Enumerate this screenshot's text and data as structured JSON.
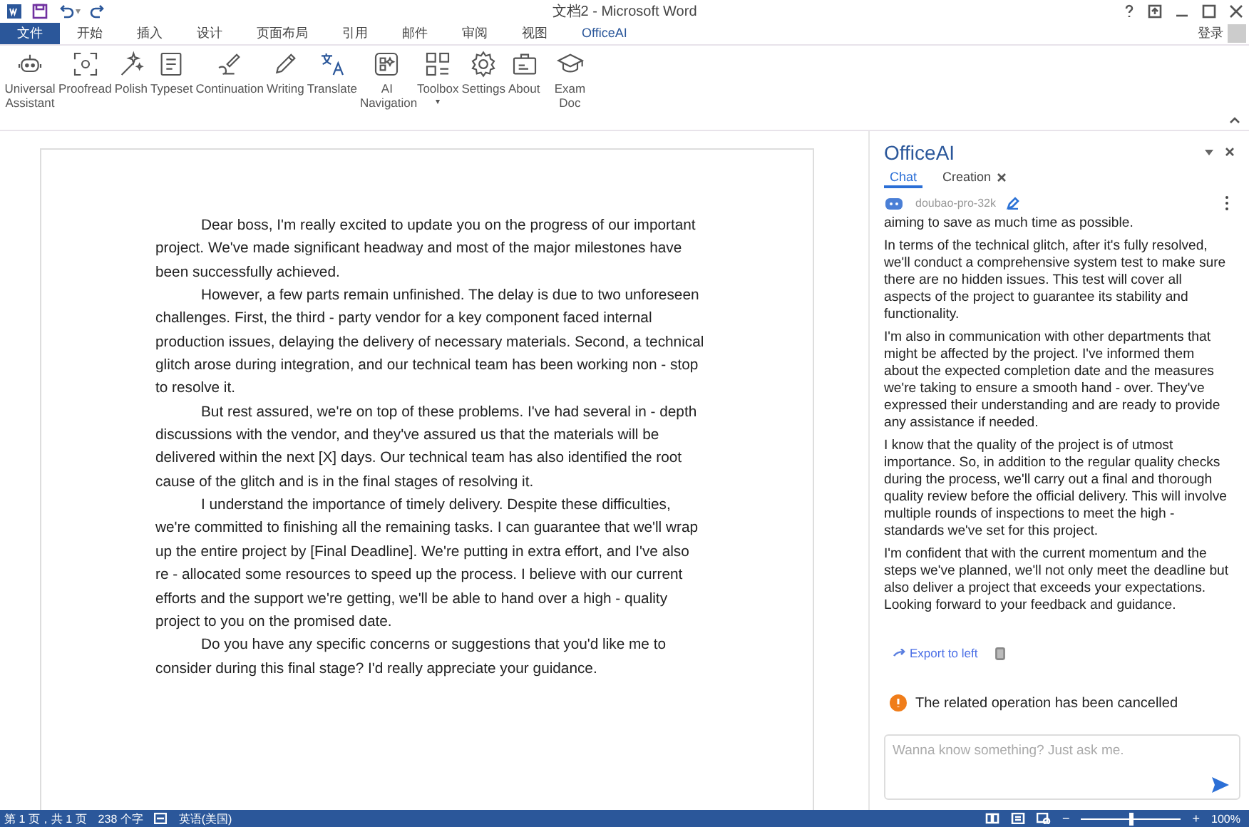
{
  "window": {
    "title": "文档2 - Microsoft Word",
    "sign_in": "登录"
  },
  "quick_access": {
    "undo_caret": "▾"
  },
  "tabs": [
    {
      "label": "文件",
      "selected": false,
      "kind": "file"
    },
    {
      "label": "开始",
      "selected": false,
      "kind": "tab"
    },
    {
      "label": "插入",
      "selected": false,
      "kind": "tab"
    },
    {
      "label": "设计",
      "selected": false,
      "kind": "tab"
    },
    {
      "label": "页面布局",
      "selected": false,
      "kind": "tab"
    },
    {
      "label": "引用",
      "selected": false,
      "kind": "tab"
    },
    {
      "label": "邮件",
      "selected": false,
      "kind": "tab"
    },
    {
      "label": "审阅",
      "selected": false,
      "kind": "tab"
    },
    {
      "label": "视图",
      "selected": false,
      "kind": "tab"
    },
    {
      "label": "OfficeAI",
      "selected": true,
      "kind": "tab"
    }
  ],
  "ribbon": [
    {
      "label": "Universal Assistant"
    },
    {
      "label": "Proofread"
    },
    {
      "label": "Polish"
    },
    {
      "label": "Typeset"
    },
    {
      "label": "Continuation"
    },
    {
      "label": "Writing"
    },
    {
      "label": "Translate"
    },
    {
      "label": "AI Navigation"
    },
    {
      "label": "Toolbox",
      "caret": "▾"
    },
    {
      "label": "Settings"
    },
    {
      "label": "About"
    },
    {
      "label": "Exam Doc"
    }
  ],
  "document": {
    "paragraphs": [
      "Dear boss, I'm really excited to update you on the progress of our important project. We've made significant headway and most of the major milestones have been successfully achieved.",
      "However, a few parts remain unfinished. The delay is due to two unforeseen challenges. First, the third - party vendor for a key component faced internal production issues, delaying the delivery of necessary materials. Second, a technical glitch arose during integration, and our technical team has been working non - stop to resolve it.",
      "But rest assured, we're on top of these problems. I've had several in - depth discussions with the vendor, and they've assured us that the materials will be delivered within the next [X] days. Our technical team has also identified the root cause of the glitch and is in the final stages of resolving it.",
      "I understand the importance of timely delivery. Despite these difficulties, we're committed to finishing all the remaining tasks. I can guarantee that we'll wrap up the entire project by [Final Deadline]. We're putting in extra effort, and I've also re - allocated some resources to speed up the process. I believe with our current efforts and the support we're getting, we'll be able to hand over a high - quality project to you on the promised date.",
      "Do you have any specific concerns or suggestions that you'd like me to consider during this final stage? I'd really appreciate your guidance."
    ]
  },
  "pane": {
    "title": "OfficeAI",
    "tabs": [
      {
        "label": "Chat",
        "selected": true,
        "closable": false
      },
      {
        "label": "Creation",
        "selected": false,
        "closable": true
      }
    ],
    "model": "doubao-pro-32k",
    "messages": [
      "aiming to save as much time as possible.",
      "In terms of the technical glitch, after it's fully resolved, we'll conduct a comprehensive system test to make sure there are no hidden issues. This test will cover all aspects of the project to guarantee its stability and functionality.",
      "I'm also in communication with other departments that might be affected by the project. I've informed them about the expected completion date and the measures we're taking to ensure a smooth hand - over. They've expressed their understanding and are ready to provide any assistance if needed.",
      "I know that the quality of the project is of utmost importance. So, in addition to the regular quality checks during the process, we'll carry out a final and thorough quality review before the official delivery. This will involve multiple rounds of inspections to meet the high - standards we've set for this project.",
      "I'm confident that with the current momentum and the steps we've planned, we'll not only meet the deadline but also deliver a project that exceeds your expectations. Looking forward to your feedback and guidance."
    ],
    "export": "Export to left",
    "notice": "The related operation has been cancelled",
    "input": {
      "placeholder": "Wanna know something? Just ask me."
    }
  },
  "status_bar": {
    "page": "第 1 页，共 1 页",
    "words": "238 个字",
    "language": "英语(美国)",
    "zoom_out": "−",
    "zoom_in": "+",
    "zoom": {
      "level": 0.5
    },
    "zoom_text": "100%"
  }
}
